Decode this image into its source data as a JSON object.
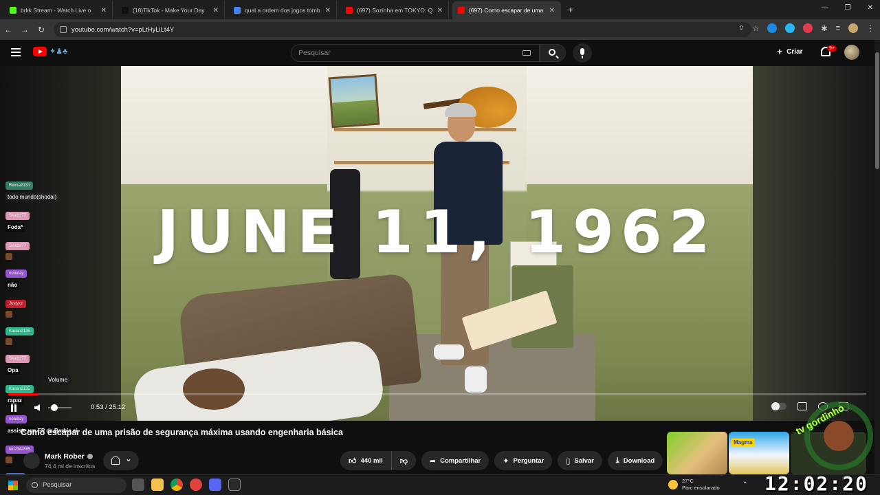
{
  "browser": {
    "tabs": [
      {
        "label": "brkk Stream - Watch Live o",
        "icon_color": "#53fc18",
        "active": false
      },
      {
        "label": "(18)TikTok - Make Your Day",
        "icon_color": "#111111",
        "active": false
      },
      {
        "label": "qual a ordem dos jogos tomb",
        "icon_color": "#4285f4",
        "active": false
      },
      {
        "label": "(697) Sozinha em TOKYO: QUA",
        "icon_color": "#ff0000",
        "active": false
      },
      {
        "label": "(697) Como escapar de uma",
        "icon_color": "#ff0000",
        "active": true
      }
    ],
    "new_tab": "+",
    "url": "youtube.com/watch?v=pLtHyLiLt4Y"
  },
  "youtube": {
    "search_placeholder": "Pesquisar",
    "create_label": "Criar",
    "notifications_badge": "9+"
  },
  "video": {
    "overlay_text": "JUNE 11, 1962",
    "current_time": "0:53",
    "duration": "25:12",
    "time_display": "0:53 / 25:12",
    "progress_fraction": 0.035,
    "volume_tooltip": "Volume",
    "title": "Como escapar de uma prisão de segurança máxima usando engenharia básica"
  },
  "channel": {
    "name": "Mark Rober",
    "subscribers": "74,4 mi de inscritos"
  },
  "actions": {
    "likes": "440 mil",
    "share": "Compartilhar",
    "ask": "Perguntar",
    "save": "Salvar",
    "download": "Download",
    "more": "⋯"
  },
  "recommendation_label": "Magma",
  "chat": [
    {
      "user": "Rexxa2133",
      "text": "todo mundo(shodai)",
      "color": "#3a8a6a",
      "style": "soft"
    },
    {
      "user": "Skudsf77",
      "text": "Foda*",
      "color": "#f4a7c8",
      "style": "bold"
    },
    {
      "user": "Skudsf77",
      "text": "",
      "color": "#f4a7c8",
      "style": "emote"
    },
    {
      "user": "noteday",
      "text": "não",
      "color": "#a35de0",
      "style": "bold"
    },
    {
      "user": "Justyxz",
      "text": "",
      "color": "#d92030",
      "style": "emote"
    },
    {
      "user": "Kauan2135",
      "text": "",
      "color": "#35c89a",
      "style": "emote"
    },
    {
      "user": "Skudsf77",
      "text": "Opa",
      "color": "#f4a7c8",
      "style": "bold"
    },
    {
      "user": "Kauan2135",
      "text": "rapaz",
      "color": "#35c89a",
      "style": "bold"
    },
    {
      "user": "noteday",
      "text": "assiste um EP de Barbie ai",
      "color": "#a35de0",
      "style": "bold"
    },
    {
      "user": "leo2344555",
      "text": "",
      "color": "#a35de0",
      "style": "emote"
    },
    {
      "user": "PVA2H",
      "text": "",
      "color": "#5a7ad0",
      "style": "none"
    }
  ],
  "overlay_badge_text": "tv gordinho",
  "taskbar": {
    "search_placeholder": "Pesquisar",
    "weather_temp": "27°C",
    "weather_desc": "Parc ensolarado",
    "clock": "12:02:20"
  }
}
